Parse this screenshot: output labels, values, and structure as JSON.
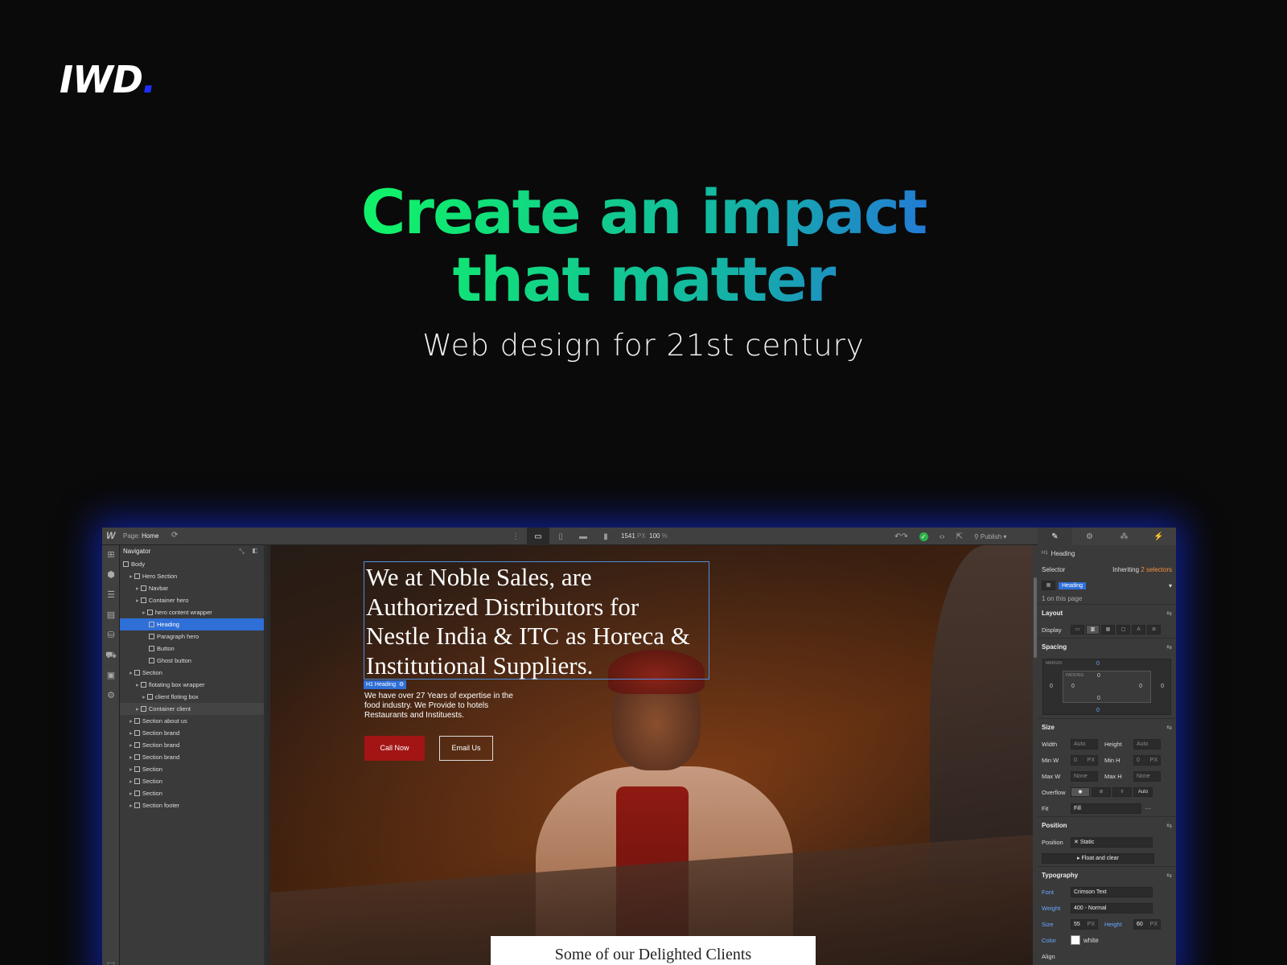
{
  "logo": {
    "text": "IWD",
    "dot": "."
  },
  "hero": {
    "title_line1": "Create an impact",
    "title_line2": "that matter",
    "subtitle": "Web design for 21st century"
  },
  "colors": {
    "background": "#0a0a0a",
    "gradient_start": "#10f06a",
    "gradient_mid": "#13b9a0",
    "gradient_end": "#2a5af0",
    "glow": "#1432ff",
    "accent_blue": "#2f6fd8",
    "cta_red": "#a31515"
  },
  "editor": {
    "topbar": {
      "app_icon": "W",
      "page_label": "Page:",
      "page_name": "Home",
      "sync_icon": "sync-icon",
      "width_value": "1541",
      "width_unit": "PX",
      "zoom_value": "100",
      "zoom_unit": "%",
      "publish_label": "Publish"
    },
    "navigator": {
      "title": "Navigator",
      "items": [
        {
          "label": "Body",
          "indent": 0
        },
        {
          "label": "Hero Section",
          "indent": 1
        },
        {
          "label": "Navbar",
          "indent": 2
        },
        {
          "label": "Container hero",
          "indent": 2
        },
        {
          "label": "hero content wrapper",
          "indent": 3
        },
        {
          "label": "Heading",
          "indent": 4
        },
        {
          "label": "Paragraph hero",
          "indent": 4
        },
        {
          "label": "Button",
          "indent": 4
        },
        {
          "label": "Ghost button",
          "indent": 4
        },
        {
          "label": "Section",
          "indent": 1
        },
        {
          "label": "flotating box wrapper",
          "indent": 2
        },
        {
          "label": "client floting box",
          "indent": 3
        },
        {
          "label": "Container client",
          "indent": 2
        },
        {
          "label": "Section about us",
          "indent": 1
        },
        {
          "label": "Section brand",
          "indent": 1
        },
        {
          "label": "Section brand",
          "indent": 1
        },
        {
          "label": "Section brand",
          "indent": 1
        },
        {
          "label": "Section",
          "indent": 1
        },
        {
          "label": "Section",
          "indent": 1
        },
        {
          "label": "Section",
          "indent": 1
        },
        {
          "label": "Section footer",
          "indent": 1
        }
      ]
    },
    "canvas": {
      "heading": "We at Noble Sales, are Authorized Distributors for Nestle India & ITC as Horeca & Institutional Suppliers.",
      "heading_tag": "H1 Heading",
      "paragraph": "We have over 27 Years of expertise in the food industry. We Provide to hotels Restaurants and Instituests.",
      "btn_call": "Call Now",
      "btn_email": "Email Us",
      "clients_title": "Some of our Delighted Clients"
    },
    "style_panel": {
      "element_name": "Heading",
      "selector_label": "Selector",
      "inheriting_label": "Inheriting",
      "inheriting_count": "2 selectors",
      "selector_chip": "Heading",
      "on_page": "1 on this page",
      "layout": {
        "title": "Layout",
        "display_label": "Display"
      },
      "spacing": {
        "title": "Spacing",
        "margin_label": "MARGIN",
        "padding_label": "PADDING",
        "margin_top": "0",
        "margin_right": "0",
        "margin_bottom": "0",
        "margin_left": "0",
        "padding_top": "0",
        "padding_right": "0",
        "padding_bottom": "0",
        "padding_left": "0"
      },
      "size": {
        "title": "Size",
        "width_label": "Width",
        "width_value": "Auto",
        "height_label": "Height",
        "height_value": "Auto",
        "minw_label": "Min W",
        "minw_value": "0",
        "minw_unit": "PX",
        "minh_label": "Min H",
        "minh_value": "0",
        "minh_unit": "PX",
        "maxw_label": "Max W",
        "maxw_value": "None",
        "maxh_label": "Max H",
        "maxh_value": "None",
        "overflow_label": "Overflow",
        "overflow_auto": "Auto",
        "fit_label": "Fit",
        "fit_value": "Fill"
      },
      "position": {
        "title": "Position",
        "label": "Position",
        "value": "Static",
        "float_label": "Float and clear"
      },
      "typography": {
        "title": "Typography",
        "font_label": "Font",
        "font_value": "Crimson Text",
        "weight_label": "Weight",
        "weight_value": "400 - Normal",
        "size_label": "Size",
        "size_value": "55",
        "size_unit": "PX",
        "height_label": "Height",
        "height_value": "60",
        "height_unit": "PX",
        "color_label": "Color",
        "color_value": "white",
        "align_label": "Align"
      }
    }
  }
}
